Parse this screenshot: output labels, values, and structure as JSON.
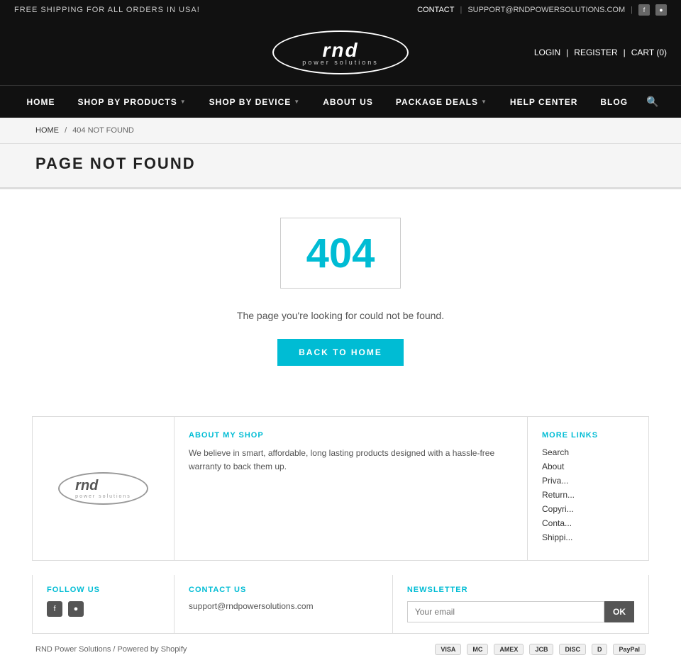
{
  "topbar": {
    "free_shipping": "FREE SHIPPING FOR ALL ORDERS IN USA!",
    "contact": "CONTACT",
    "email": "SUPPORT@RNDPOWERSOLUTIONS.COM",
    "separator1": "|",
    "separator2": "|"
  },
  "header": {
    "login": "LOGIN",
    "register": "REGISTER",
    "cart": "CART (0)",
    "logo_main": "rnd",
    "logo_sub": "power solutions",
    "sep1": "|",
    "sep2": "|"
  },
  "nav": {
    "items": [
      {
        "label": "HOME",
        "has_arrow": false
      },
      {
        "label": "SHOP BY PRODUCTS",
        "has_arrow": true
      },
      {
        "label": "SHOP BY DEVICE",
        "has_arrow": true
      },
      {
        "label": "ABOUT US",
        "has_arrow": false
      },
      {
        "label": "PACKAGE DEALS",
        "has_arrow": true
      },
      {
        "label": "HELP CENTER",
        "has_arrow": false
      },
      {
        "label": "BLOG",
        "has_arrow": false
      }
    ]
  },
  "breadcrumb": {
    "home": "HOME",
    "separator": "/",
    "current": "404 NOT FOUND"
  },
  "page_header": {
    "title": "PAGE NOT FOUND"
  },
  "error": {
    "code": "404",
    "message": "The page you're looking for could not be found.",
    "back_button": "BACK TO HOME"
  },
  "footer": {
    "about_section_title": "ABOUT MY SHOP",
    "about_text": "We believe in smart, affordable, long lasting products designed with a hassle-free warranty to back them up.",
    "links_section_title": "MORE LINKS",
    "links": [
      {
        "label": "Search"
      },
      {
        "label": "About"
      },
      {
        "label": "Priva..."
      },
      {
        "label": "Return..."
      },
      {
        "label": "Copyri..."
      },
      {
        "label": "Conta..."
      },
      {
        "label": "Shippi..."
      }
    ],
    "follow_title": "FOLLOW US",
    "contact_title": "CONTACT US",
    "contact_email": "support@rndpowersolutions.com",
    "newsletter_title": "NEWSLETTER",
    "newsletter_placeholder": "Your email",
    "newsletter_btn": "OK"
  },
  "very_bottom": {
    "copyright": "RND Power Solutions / Powered by Shopify",
    "payment_icons": [
      "VISA",
      "MC",
      "AMEX",
      "JCB",
      "DISC",
      "D",
      "PayPal"
    ]
  }
}
